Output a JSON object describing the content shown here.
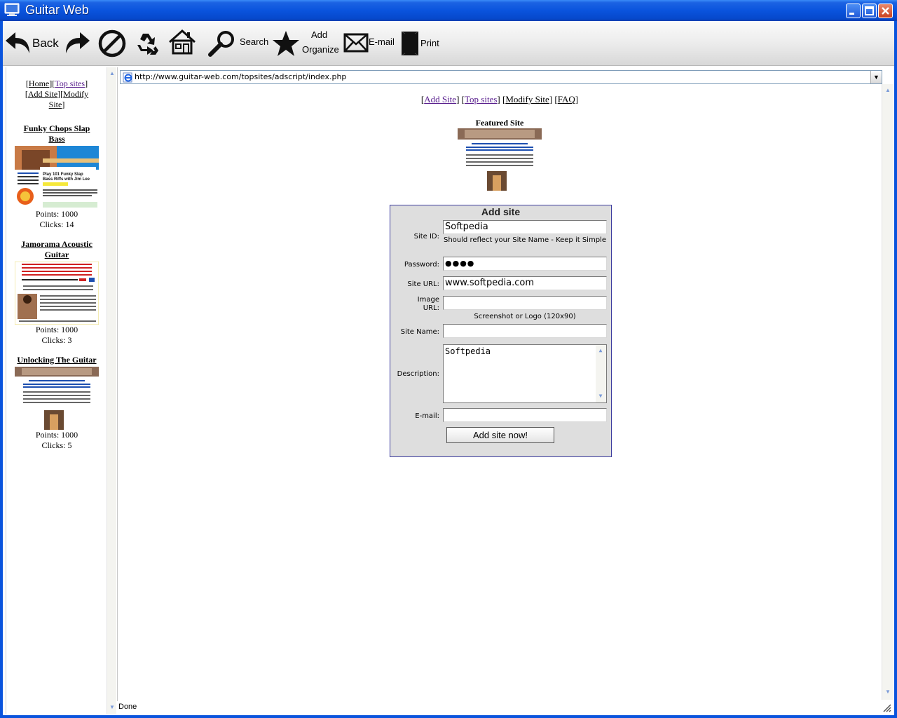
{
  "window": {
    "title": "Guitar Web"
  },
  "toolbar": {
    "back_label": "Back",
    "search_label": "Search",
    "add_label": "Add",
    "organize_label": "Organize",
    "email_label": "E-mail",
    "print_label": "Print"
  },
  "address": {
    "url": "http://www.guitar-web.com/topsites/adscript/index.php"
  },
  "sidebar": {
    "nav": {
      "home": "Home",
      "top_sites": "Top sites",
      "add_site": "Add Site",
      "modify_site_1": "Modify",
      "modify_site_2": "Site"
    },
    "entries": [
      {
        "title_1": "Funky Chops Slap",
        "title_2": "Bass",
        "points": "Points: 1000",
        "clicks": "Clicks: 14",
        "thumb_text": "Play 101 Funky Slap Bass Riffs with Jim Lee"
      },
      {
        "title_1": "Jamorama Acoustic",
        "title_2": "Guitar",
        "points": "Points: 1000",
        "clicks": "Clicks: 3"
      },
      {
        "title_1": "Unlocking The Guitar",
        "points": "Points: 1000",
        "clicks": "Clicks: 5"
      }
    ]
  },
  "main": {
    "links": {
      "add_site": "Add Site",
      "top_sites": "Top sites",
      "modify_site": "Modify Site",
      "faq": "FAQ"
    },
    "featured_label": "Featured Site"
  },
  "form": {
    "title": "Add site",
    "site_id_label": "Site ID:",
    "site_id_value": "Softpedia",
    "site_id_hint": "Should reflect your Site Name - Keep it Simple",
    "password_label": "Password:",
    "password_value": "●●●●",
    "site_url_label": "Site URL:",
    "site_url_value": "www.softpedia.com",
    "image_url_label_1": "Image",
    "image_url_label_2": "URL:",
    "image_url_value": "",
    "image_hint": "Screenshot or Logo (120x90)",
    "site_name_label": "Site Name:",
    "site_name_value": "",
    "description_label": "Description:",
    "description_value": "Softpedia",
    "email_label": "E-mail:",
    "email_value": "",
    "submit_label": "Add site now!"
  },
  "status": {
    "text": "Done"
  },
  "colors": {
    "titlebar": "#0a54dd",
    "form_border": "#3a3a9e",
    "form_background": "#dedede",
    "visited_link": "#551a8b"
  }
}
